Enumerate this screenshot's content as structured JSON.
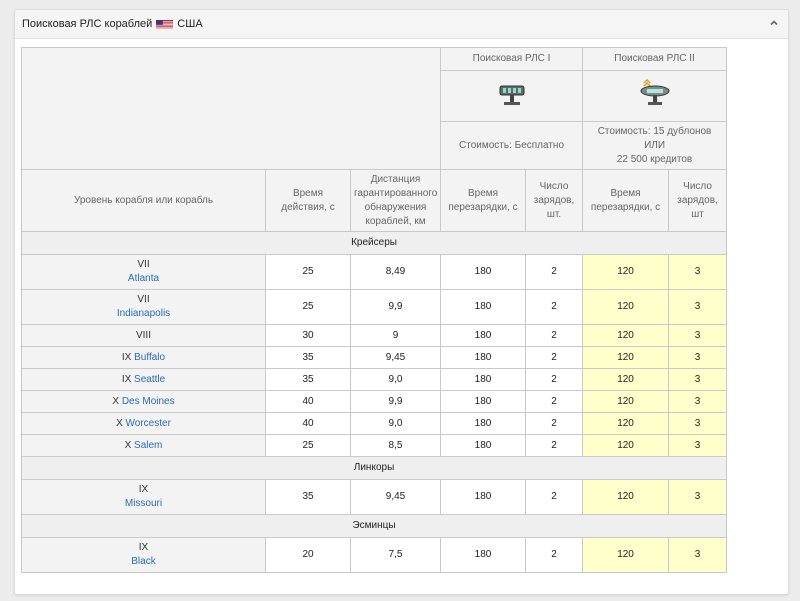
{
  "header": {
    "title": "Поисковая РЛС кораблей",
    "country": "США",
    "flag_icon": "us-flag-icon",
    "toggle_icon": "chevron-up-icon"
  },
  "table": {
    "radar1": {
      "name": "Поисковая РЛС I",
      "icon": "radar-module-icon",
      "cost": "Стоимость: Бесплатно"
    },
    "radar2": {
      "name": "Поисковая РЛС II",
      "icon": "radar-module-upgraded-icon",
      "cost_line1": "Стоимость: 15 дублонов",
      "cost_line2": "ИЛИ",
      "cost_line3": "22 500 кредитов"
    },
    "columns": {
      "ship": "Уровень корабля или корабль",
      "duration": "Время действия, с",
      "distance": "Дистанция гарантированного обнаружения кораблей, км",
      "reload1": "Время перезарядки, с",
      "charges1": "Число зарядов, шт.",
      "reload2": "Время перезарядки, с",
      "charges2": "Число зарядов, шт"
    },
    "highlight_color": "#ffffcc",
    "sections": [
      {
        "title": "Крейсеры",
        "rows": [
          {
            "tier": "VII",
            "ship": "Atlanta",
            "duration": "25",
            "distance": "8,49",
            "reload1": "180",
            "charges1": "2",
            "reload2": "120",
            "charges2": "3"
          },
          {
            "tier": "VII",
            "ship": "Indianapolis",
            "duration": "25",
            "distance": "9,9",
            "reload1": "180",
            "charges1": "2",
            "reload2": "120",
            "charges2": "3"
          },
          {
            "tier": "VIII",
            "ship": "",
            "duration": "30",
            "distance": "9",
            "reload1": "180",
            "charges1": "2",
            "reload2": "120",
            "charges2": "3"
          },
          {
            "tier": "IX",
            "ship": "Buffalo",
            "duration": "35",
            "distance": "9,45",
            "reload1": "180",
            "charges1": "2",
            "reload2": "120",
            "charges2": "3"
          },
          {
            "tier": "IX",
            "ship": "Seattle",
            "duration": "35",
            "distance": "9,0",
            "reload1": "180",
            "charges1": "2",
            "reload2": "120",
            "charges2": "3"
          },
          {
            "tier": "X",
            "ship": "Des Moines",
            "duration": "40",
            "distance": "9,9",
            "reload1": "180",
            "charges1": "2",
            "reload2": "120",
            "charges2": "3"
          },
          {
            "tier": "X",
            "ship": "Worcester",
            "duration": "40",
            "distance": "9,0",
            "reload1": "180",
            "charges1": "2",
            "reload2": "120",
            "charges2": "3"
          },
          {
            "tier": "X",
            "ship": "Salem",
            "duration": "25",
            "distance": "8,5",
            "reload1": "180",
            "charges1": "2",
            "reload2": "120",
            "charges2": "3"
          }
        ]
      },
      {
        "title": "Линкоры",
        "rows": [
          {
            "tier": "IX",
            "ship": "Missouri",
            "duration": "35",
            "distance": "9,45",
            "reload1": "180",
            "charges1": "2",
            "reload2": "120",
            "charges2": "3"
          }
        ]
      },
      {
        "title": "Эсминцы",
        "rows": [
          {
            "tier": "IX",
            "ship": "Black",
            "duration": "20",
            "distance": "7,5",
            "reload1": "180",
            "charges1": "2",
            "reload2": "120",
            "charges2": "3"
          }
        ]
      }
    ]
  }
}
